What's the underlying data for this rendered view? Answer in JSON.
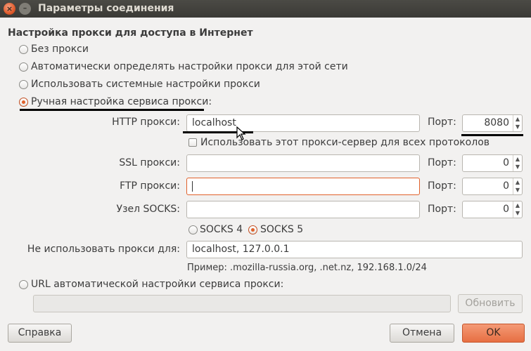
{
  "window": {
    "title": "Параметры соединения",
    "close_icon": "close-icon",
    "minimize_icon": "minimize-icon"
  },
  "section_title": "Настройка прокси для доступа в Интернет",
  "proxy_modes": [
    {
      "label": "Без прокси",
      "checked": false
    },
    {
      "label": "Автоматически определять настройки прокси для этой сети",
      "checked": false
    },
    {
      "label": "Использовать системные настройки прокси",
      "checked": false
    },
    {
      "label": "Ручная настройка сервиса прокси:",
      "checked": true
    }
  ],
  "http": {
    "label": "HTTP прокси:",
    "value": "localhost",
    "port_label": "Порт:",
    "port": "8080"
  },
  "share_all": {
    "label": "Использовать этот прокси-сервер для всех протоколов",
    "checked": false
  },
  "ssl": {
    "label": "SSL прокси:",
    "value": "",
    "port_label": "Порт:",
    "port": "0"
  },
  "ftp": {
    "label": "FTP прокси:",
    "value": "",
    "port_label": "Порт:",
    "port": "0"
  },
  "socks": {
    "label": "Узел SOCKS:",
    "value": "",
    "port_label": "Порт:",
    "port": "0"
  },
  "socks_versions": [
    {
      "label": "SOCKS 4",
      "checked": false
    },
    {
      "label": "SOCKS 5",
      "checked": true
    }
  ],
  "no_proxy": {
    "label": "Не использовать прокси для:",
    "value": "localhost, 127.0.0.1"
  },
  "example": "Пример: .mozilla-russia.org, .net.nz, 192.168.1.0/24",
  "auto_url": {
    "label": "URL автоматической настройки сервиса прокси:",
    "checked": false,
    "value": "",
    "reload_label": "Обновить"
  },
  "buttons": {
    "help": "Справка",
    "cancel": "Отмена",
    "ok": "OK"
  },
  "colors": {
    "accent": "#e0612b",
    "titlebar": "#3b3a36",
    "background": "#f2f1f0"
  }
}
